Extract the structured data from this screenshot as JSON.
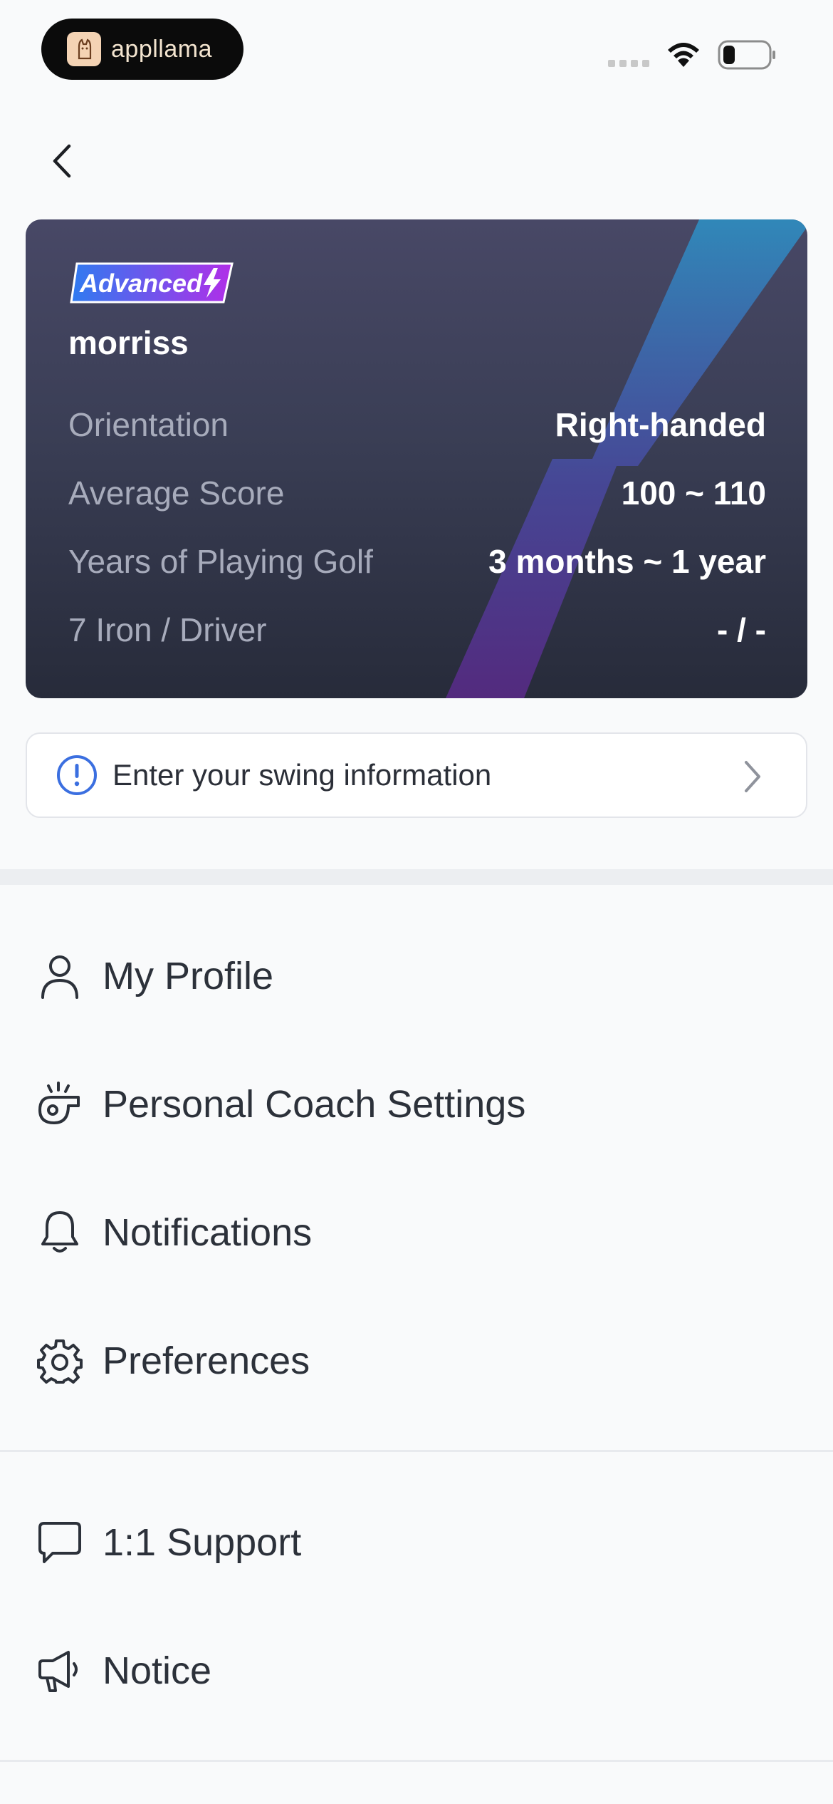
{
  "status_bar": {
    "carrier": "appllama"
  },
  "card": {
    "badge": "Advanced",
    "username": "morriss",
    "stats": [
      {
        "label": "Orientation",
        "value": "Right-handed"
      },
      {
        "label": "Average Score",
        "value": "100 ~ 110"
      },
      {
        "label": "Years of Playing Golf",
        "value": "3 months ~ 1 year"
      },
      {
        "label": "7 Iron / Driver",
        "value": "- / -"
      }
    ]
  },
  "swing_info": {
    "label": "Enter your swing information"
  },
  "menu": {
    "account": [
      {
        "label": "My Profile",
        "icon": "person-icon"
      },
      {
        "label": "Personal Coach Settings",
        "icon": "whistle-icon"
      },
      {
        "label": "Notifications",
        "icon": "bell-icon"
      },
      {
        "label": "Preferences",
        "icon": "gear-icon"
      }
    ],
    "support": [
      {
        "label": "1:1 Support",
        "icon": "chat-bubble-icon"
      },
      {
        "label": "Notice",
        "icon": "megaphone-icon"
      }
    ]
  },
  "colors": {
    "accent_blue": "#3b6fe0",
    "card_top": "#484866",
    "card_bottom": "#272b3a",
    "badge_gradient_start": "#2f7bf0",
    "badge_gradient_end": "#b12ee8"
  }
}
